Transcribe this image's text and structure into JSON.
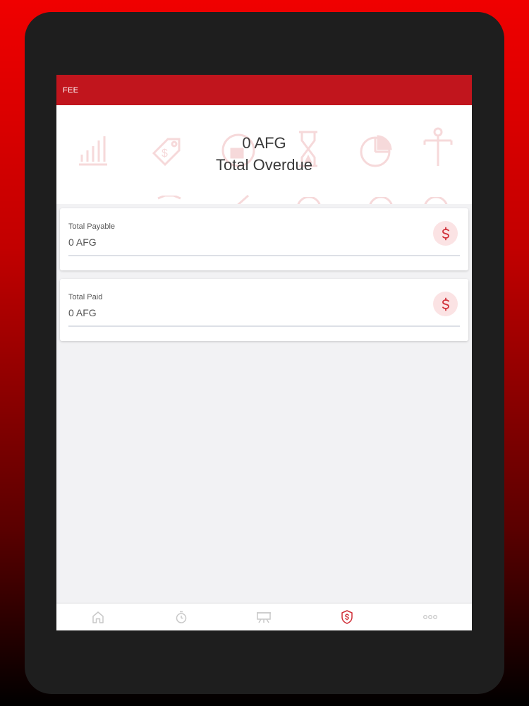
{
  "appbar": {
    "title": "FEE"
  },
  "summary": {
    "amount": "0 AFG",
    "label": "Total Overdue"
  },
  "cards": [
    {
      "label": "Total Payable",
      "value": "0 AFG",
      "icon": "dollar-icon"
    },
    {
      "label": "Total Paid",
      "value": "0 AFG",
      "icon": "dollar-icon"
    }
  ],
  "bottom_nav": [
    {
      "icon": "home-icon",
      "active": false
    },
    {
      "icon": "stopwatch-icon",
      "active": false
    },
    {
      "icon": "presentation-board-icon",
      "active": false
    },
    {
      "icon": "fee-shield-icon",
      "active": true
    },
    {
      "icon": "more-icon",
      "active": false
    }
  ],
  "colors": {
    "brand": "#c1151d",
    "accent": "#d0313a",
    "accent_light": "#fbe3e4",
    "inactive_icon": "#c8c8c8",
    "background": "#f2f2f4"
  }
}
